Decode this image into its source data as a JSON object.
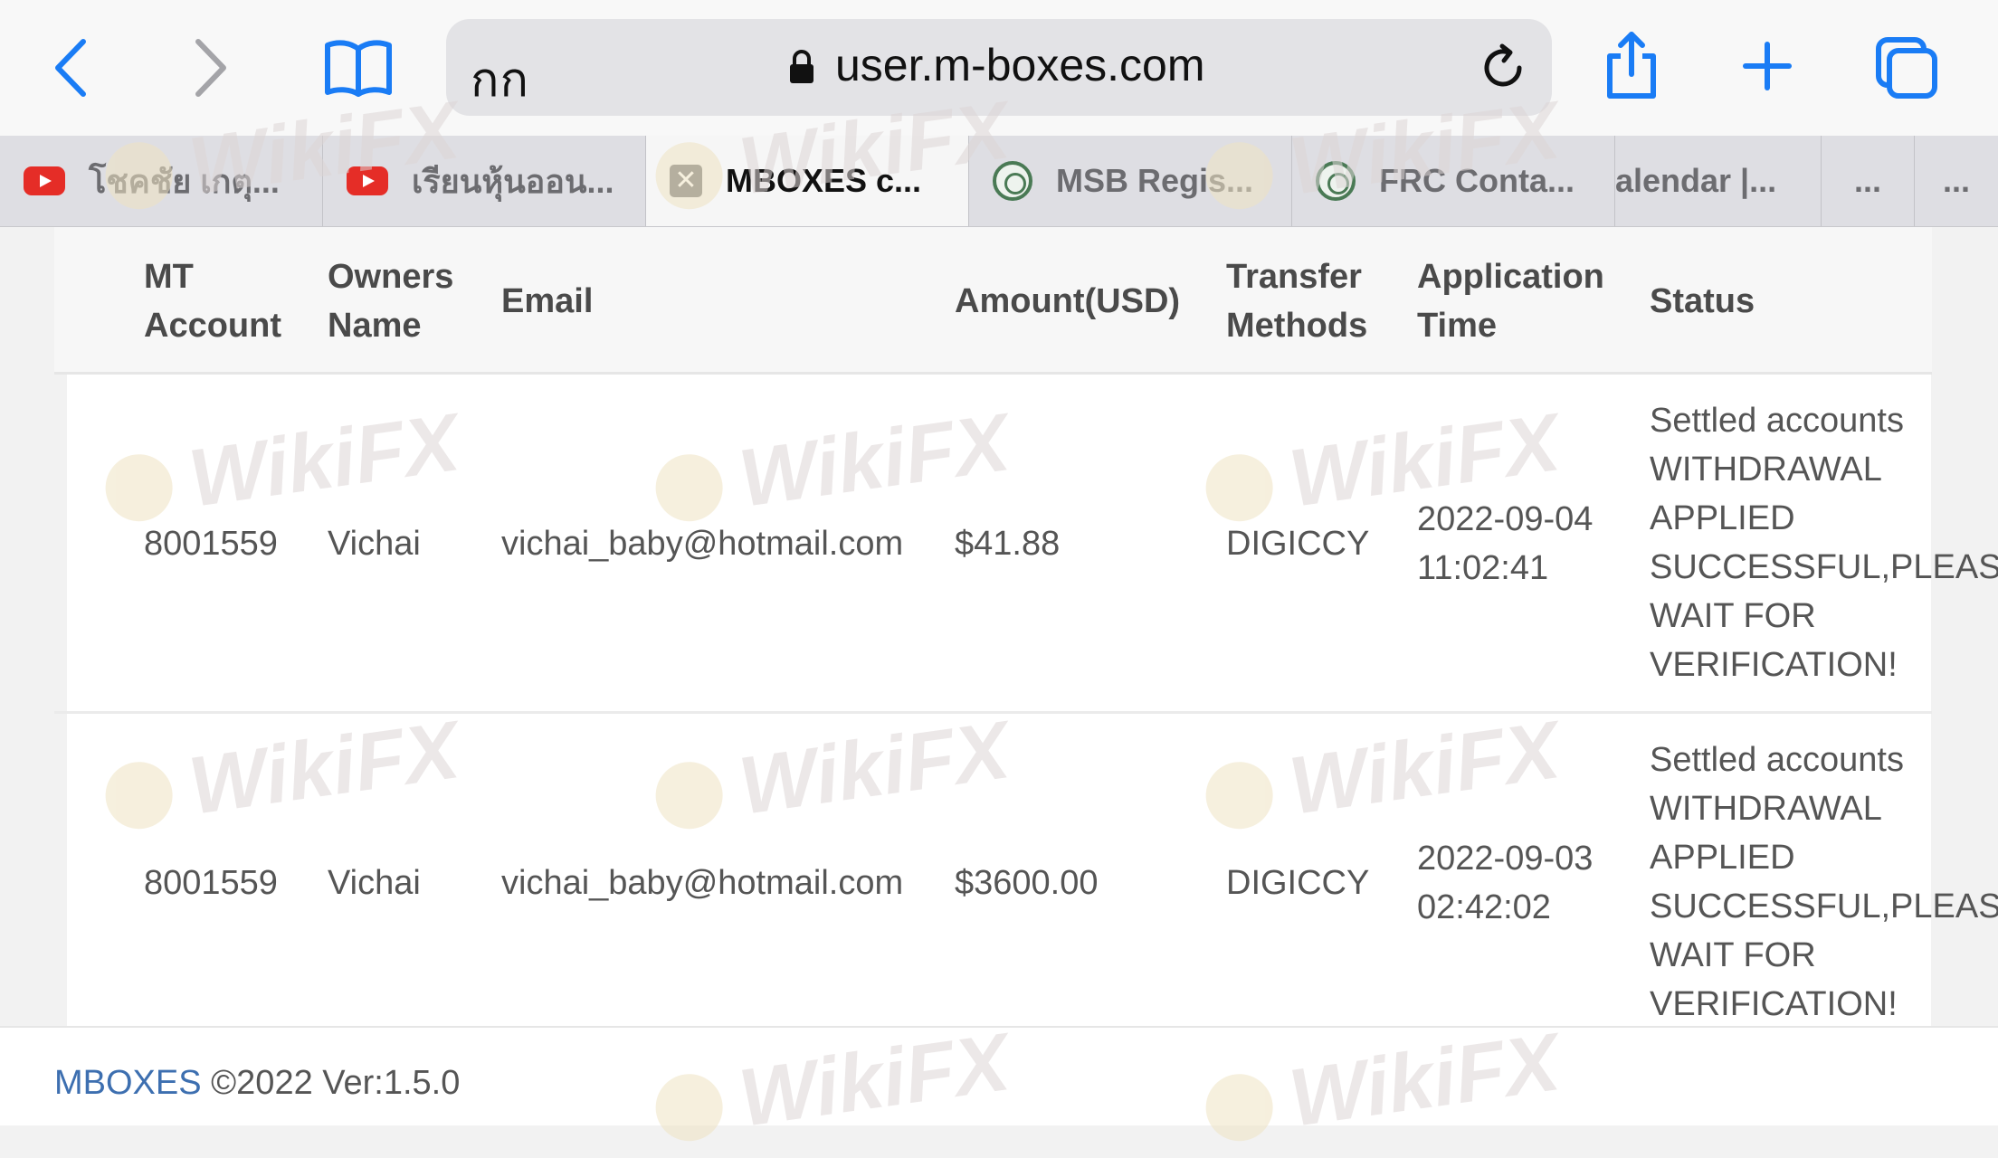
{
  "browser": {
    "text_size_label": "กก",
    "url": "user.m-boxes.com",
    "tabs": [
      {
        "title": "โชคชัย เกตุ...",
        "favicon": "youtube-icon",
        "active": false
      },
      {
        "title": "เรียนหุ้นออน...",
        "favicon": "youtube-icon",
        "active": false
      },
      {
        "title": "MBOXES c...",
        "favicon": "close-tab-icon",
        "active": true
      },
      {
        "title": "MSB Regis...",
        "favicon": "seal-icon",
        "active": false
      },
      {
        "title": "FRC Conta...",
        "favicon": "seal-icon",
        "active": false
      },
      {
        "title": "alendar |...",
        "favicon": "",
        "active": false
      },
      {
        "title": "...",
        "favicon": "",
        "active": false
      },
      {
        "title": "...",
        "favicon": "",
        "active": false
      }
    ]
  },
  "table": {
    "headers": {
      "mt_account": [
        "MT",
        "Account"
      ],
      "owners_name": [
        "Owners",
        "Name"
      ],
      "email": "Email",
      "amount": "Amount(USD)",
      "transfer_methods": [
        "Transfer",
        "Methods"
      ],
      "application_time": [
        "Application",
        "Time"
      ],
      "status": "Status"
    },
    "rows": [
      {
        "mt_account": "8001559",
        "owners_name": "Vichai",
        "email": "vichai_baby@hotmail.com",
        "amount": "$41.88",
        "transfer_method": "DIGICCY",
        "time": [
          "2022-09-04",
          "11:02:41"
        ],
        "status": [
          "Settled accounts",
          "WITHDRAWAL",
          "APPLIED",
          "SUCCESSFUL,PLEASE",
          "WAIT FOR",
          "VERIFICATION!"
        ]
      },
      {
        "mt_account": "8001559",
        "owners_name": "Vichai",
        "email": "vichai_baby@hotmail.com",
        "amount": "$3600.00",
        "transfer_method": "DIGICCY",
        "time": [
          "2022-09-03",
          "02:42:02"
        ],
        "status": [
          "Settled accounts",
          "WITHDRAWAL",
          "APPLIED",
          "SUCCESSFUL,PLEASE",
          "WAIT FOR",
          "VERIFICATION!"
        ]
      }
    ]
  },
  "footer": {
    "brand": "MBOXES",
    "text": "©2022 Ver:1.5.0"
  },
  "watermark": "WikiFX",
  "colors": {
    "link_blue": "#3d6fb0",
    "ios_blue": "#1a7cf5",
    "youtube_red": "#e52d27"
  }
}
